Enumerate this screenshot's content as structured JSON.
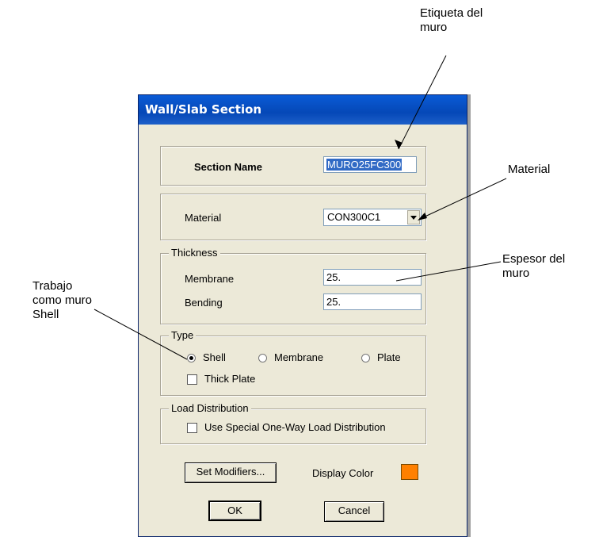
{
  "annotations": {
    "label_tag": "Etiqueta del\nmuro",
    "material": "Material",
    "thickness": "Espesor del\nmuro",
    "shell": "Trabajo\ncomo muro\nShell"
  },
  "dialog": {
    "title": "Wall/Slab Section",
    "section_name_label": "Section Name",
    "section_name_value": "MURO25FC300",
    "material_label": "Material",
    "material_value": "CON300C1",
    "thickness_legend": "Thickness",
    "membrane_label": "Membrane",
    "membrane_value": "25.",
    "bending_label": "Bending",
    "bending_value": "25.",
    "type_legend": "Type",
    "type_options": [
      "Shell",
      "Membrane",
      "Plate"
    ],
    "type_selected": "Shell",
    "thick_plate_label": "Thick Plate",
    "thick_plate_checked": false,
    "load_legend": "Load Distribution",
    "load_option_label": "Use Special One-Way Load Distribution",
    "load_option_checked": false,
    "set_modifiers_label": "Set Modifiers...",
    "display_color_label": "Display Color",
    "display_color": "#ff8000",
    "ok_label": "OK",
    "cancel_label": "Cancel"
  }
}
